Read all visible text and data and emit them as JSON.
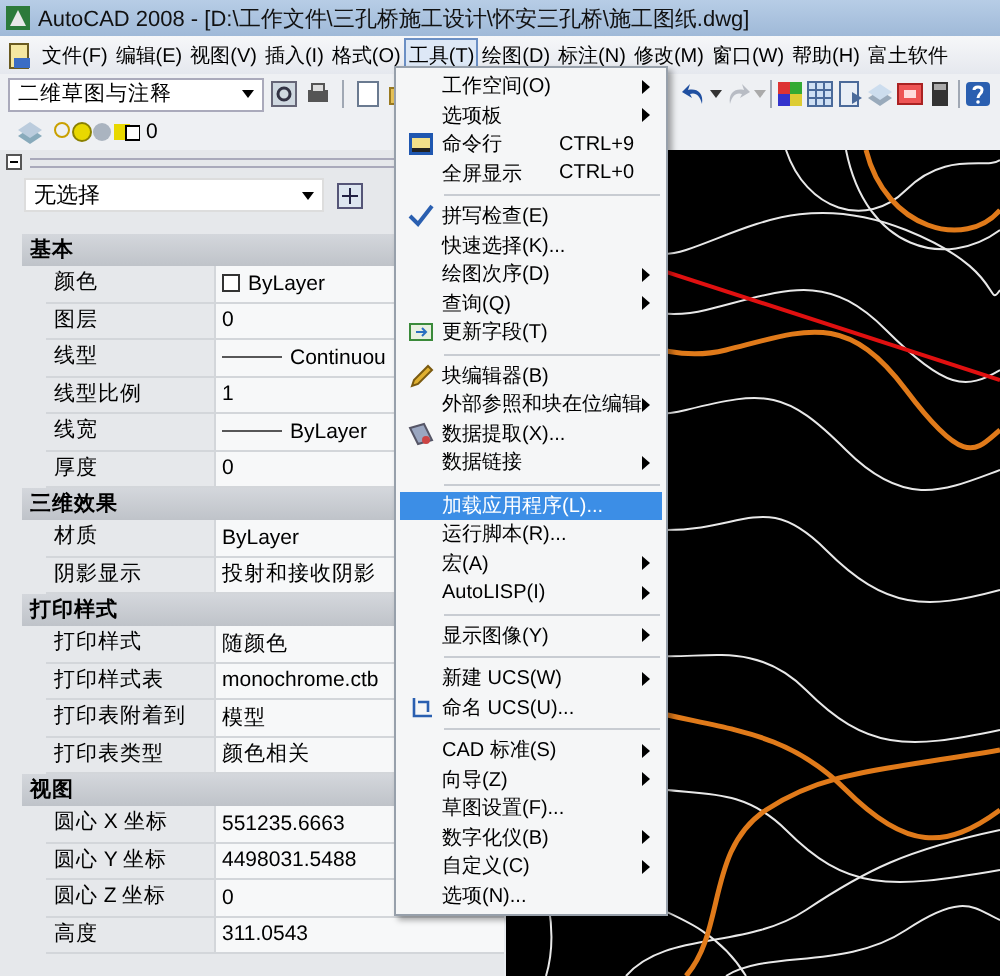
{
  "window": {
    "title": "AutoCAD 2008 - [D:\\工作文件\\三孔桥施工设计\\怀安三孔桥\\施工图纸.dwg]"
  },
  "menu_bar": [
    {
      "label": "文件(F)",
      "selected": false
    },
    {
      "label": "编辑(E)",
      "selected": false
    },
    {
      "label": "视图(V)",
      "selected": false
    },
    {
      "label": "插入(I)",
      "selected": false
    },
    {
      "label": "格式(O)",
      "selected": false
    },
    {
      "label": "工具(T)",
      "selected": true
    },
    {
      "label": "绘图(D)",
      "selected": false
    },
    {
      "label": "标注(N)",
      "selected": false
    },
    {
      "label": "修改(M)",
      "selected": false
    },
    {
      "label": "窗口(W)",
      "selected": false
    },
    {
      "label": "帮助(H)",
      "selected": false
    },
    {
      "label": "富土软件",
      "selected": false
    }
  ],
  "toolbar": {
    "workspace": "二维草图与注释",
    "layer": "0"
  },
  "properties": {
    "selection": "无选择",
    "sections": [
      {
        "title": "基本",
        "rows": [
          {
            "label": "颜色",
            "value": "ByLayer",
            "kind": "swatch"
          },
          {
            "label": "图层",
            "value": "0",
            "kind": "text"
          },
          {
            "label": "线型",
            "value": "Continuou",
            "kind": "line"
          },
          {
            "label": "线型比例",
            "value": "1",
            "kind": "text"
          },
          {
            "label": "线宽",
            "value": "ByLayer",
            "kind": "line"
          },
          {
            "label": "厚度",
            "value": "0",
            "kind": "text"
          }
        ]
      },
      {
        "title": "三维效果",
        "rows": [
          {
            "label": "材质",
            "value": "ByLayer",
            "kind": "text"
          },
          {
            "label": "阴影显示",
            "value": "投射和接收阴影",
            "kind": "text"
          }
        ]
      },
      {
        "title": "打印样式",
        "rows": [
          {
            "label": "打印样式",
            "value": "随颜色",
            "kind": "text"
          },
          {
            "label": "打印样式表",
            "value": "monochrome.ctb",
            "kind": "text"
          },
          {
            "label": "打印表附着到",
            "value": "模型",
            "kind": "text"
          },
          {
            "label": "打印表类型",
            "value": "颜色相关",
            "kind": "text"
          }
        ]
      },
      {
        "title": "视图",
        "rows": [
          {
            "label": "圆心 X 坐标",
            "value": "551235.6663",
            "kind": "text"
          },
          {
            "label": "圆心 Y 坐标",
            "value": "4498031.5488",
            "kind": "text"
          },
          {
            "label": "圆心 Z 坐标",
            "value": "0",
            "kind": "text"
          },
          {
            "label": "高度",
            "value": "311.0543",
            "kind": "text"
          }
        ]
      }
    ]
  },
  "tools_menu": [
    {
      "kind": "item",
      "label": "工作空间(O)",
      "submenu": true,
      "selected": false
    },
    {
      "kind": "item",
      "label": "选项板",
      "submenu": true,
      "selected": false
    },
    {
      "kind": "item",
      "label": "命令行",
      "shortcut": "CTRL+9",
      "submenu": false,
      "selected": false
    },
    {
      "kind": "item",
      "label": "全屏显示",
      "shortcut": "CTRL+0",
      "submenu": false,
      "selected": false
    },
    {
      "kind": "separator"
    },
    {
      "kind": "item",
      "label": "拼写检查(E)",
      "submenu": false,
      "selected": false
    },
    {
      "kind": "item",
      "label": "快速选择(K)...",
      "submenu": false,
      "selected": false
    },
    {
      "kind": "item",
      "label": "绘图次序(D)",
      "submenu": true,
      "selected": false
    },
    {
      "kind": "item",
      "label": "查询(Q)",
      "submenu": true,
      "selected": false
    },
    {
      "kind": "item",
      "label": "更新字段(T)",
      "submenu": false,
      "selected": false
    },
    {
      "kind": "separator"
    },
    {
      "kind": "item",
      "label": "块编辑器(B)",
      "submenu": false,
      "selected": false
    },
    {
      "kind": "item",
      "label": "外部参照和块在位编辑",
      "submenu": true,
      "selected": false
    },
    {
      "kind": "item",
      "label": "数据提取(X)...",
      "submenu": false,
      "selected": false
    },
    {
      "kind": "item",
      "label": "数据链接",
      "submenu": true,
      "selected": false
    },
    {
      "kind": "separator"
    },
    {
      "kind": "item",
      "label": "加载应用程序(L)...",
      "submenu": false,
      "selected": true
    },
    {
      "kind": "item",
      "label": "运行脚本(R)...",
      "submenu": false,
      "selected": false
    },
    {
      "kind": "item",
      "label": "宏(A)",
      "submenu": true,
      "selected": false
    },
    {
      "kind": "item",
      "label": "AutoLISP(I)",
      "submenu": true,
      "selected": false
    },
    {
      "kind": "separator"
    },
    {
      "kind": "item",
      "label": "显示图像(Y)",
      "submenu": true,
      "selected": false
    },
    {
      "kind": "separator"
    },
    {
      "kind": "item",
      "label": "新建 UCS(W)",
      "submenu": true,
      "selected": false
    },
    {
      "kind": "item",
      "label": "命名 UCS(U)...",
      "submenu": false,
      "selected": false
    },
    {
      "kind": "separator"
    },
    {
      "kind": "item",
      "label": "CAD 标准(S)",
      "submenu": true,
      "selected": false
    },
    {
      "kind": "item",
      "label": "向导(Z)",
      "submenu": true,
      "selected": false
    },
    {
      "kind": "item",
      "label": "草图设置(F)...",
      "submenu": false,
      "selected": false
    },
    {
      "kind": "item",
      "label": "数字化仪(B)",
      "submenu": true,
      "selected": false
    },
    {
      "kind": "item",
      "label": "自定义(C)",
      "submenu": true,
      "selected": false
    },
    {
      "kind": "item",
      "label": "选项(N)...",
      "submenu": false,
      "selected": false
    }
  ]
}
